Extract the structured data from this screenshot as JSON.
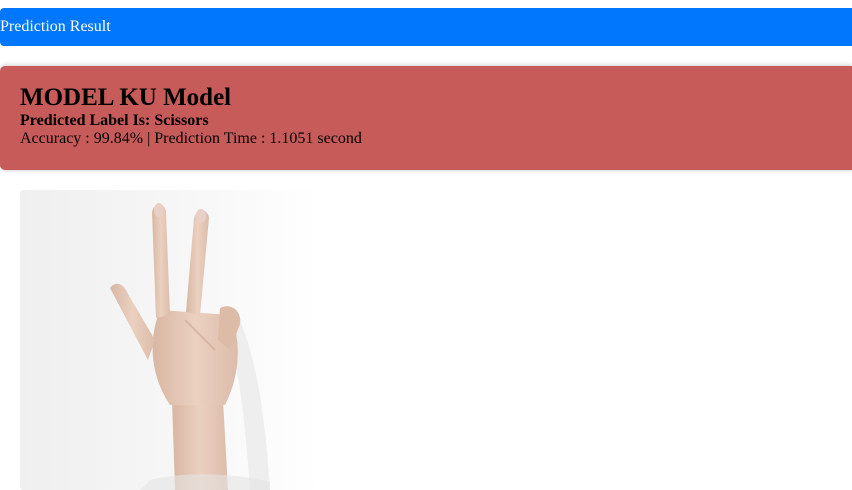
{
  "header": {
    "title": "Prediction Result"
  },
  "result": {
    "model_title": "MODEL KU Model",
    "predicted_label": "Predicted Label Is: Scissors",
    "metrics_line": "Accuracy : 99.84% | Prediction Time : 1.1051 second"
  },
  "image": {
    "subject": "hand-scissors-gesture"
  },
  "colors": {
    "header_bg": "#0077fc",
    "card_bg": "#c75b59"
  }
}
